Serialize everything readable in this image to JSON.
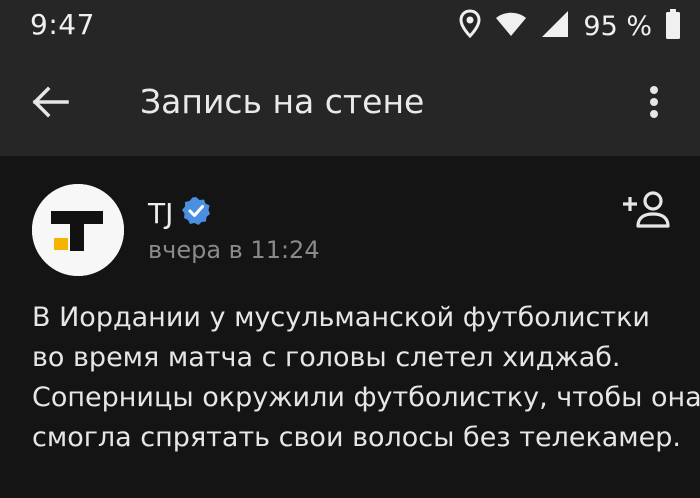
{
  "status_bar": {
    "time": "9:47",
    "battery": "95 %",
    "icons": [
      "location-icon",
      "wifi-icon",
      "signal-icon",
      "battery-icon"
    ]
  },
  "app_bar": {
    "title": "Запись на стене",
    "back_icon": "arrow-left-icon",
    "more_icon": "more-vertical-icon"
  },
  "post": {
    "author": "TJ",
    "verified": true,
    "time": "вчера в 11:24",
    "text_lines": [
      "В Иордании у мусульманской футболистки",
      "во время матча с головы слетел хиджаб.",
      "Соперницы окружили футболистку, чтобы она",
      "смогла спрятать свои волосы без телекамер."
    ],
    "add_friend_icon": "add-person-icon"
  },
  "colors": {
    "app_bar_bg": "#262626",
    "content_bg": "#141414",
    "verified_badge": "#4a8fe0",
    "logo_accent": "#f5b400"
  }
}
